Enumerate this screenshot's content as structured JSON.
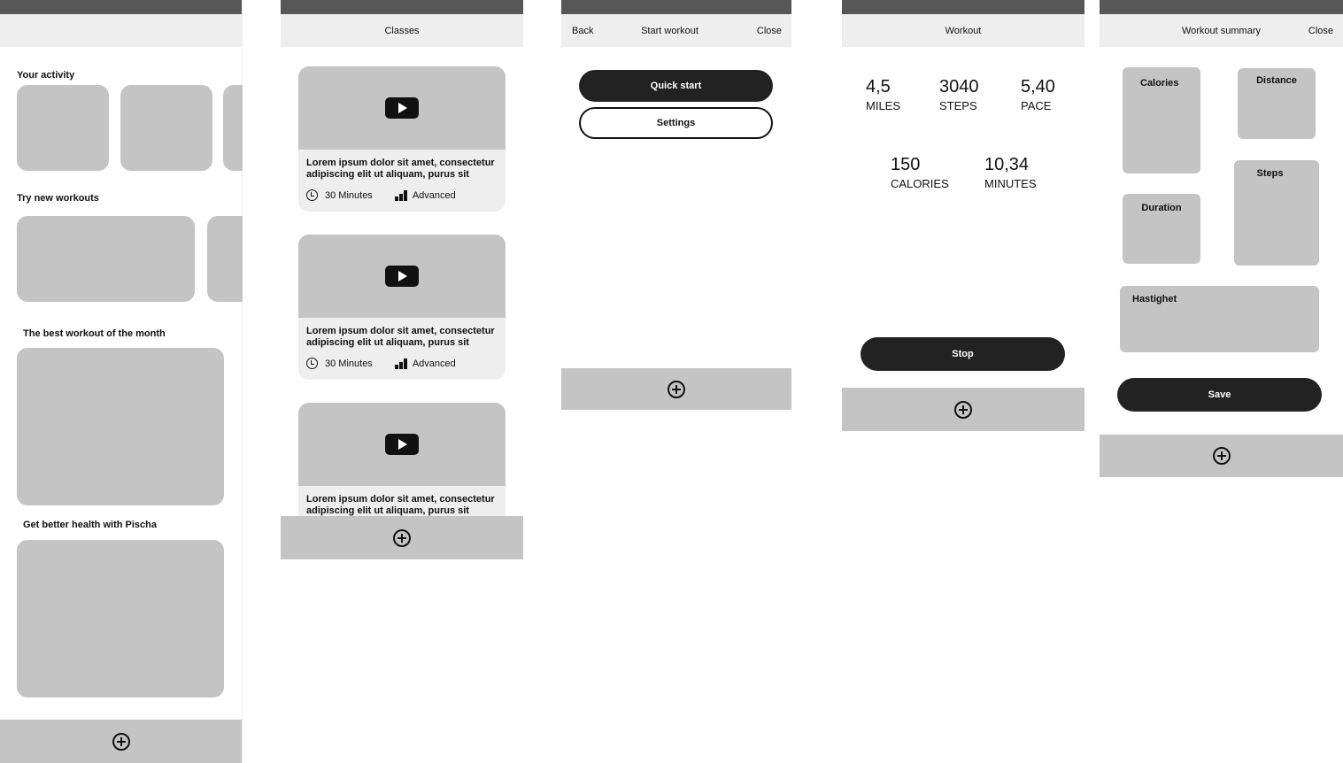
{
  "home": {
    "sections": [
      "Your activity",
      "Try new workouts",
      "The best workout of the month",
      "Get better health with Pischa"
    ]
  },
  "classes": {
    "title": "Classes",
    "cards": [
      {
        "description": "Lorem ipsum dolor sit amet, consectetur adipiscing elit ut aliquam, purus sit",
        "duration": "30 Minutes",
        "level": "Advanced"
      },
      {
        "description": "Lorem ipsum dolor sit amet, consectetur adipiscing elit ut aliquam, purus sit",
        "duration": "30 Minutes",
        "level": "Advanced"
      },
      {
        "description": "Lorem ipsum dolor sit amet, consectetur adipiscing elit ut aliquam, purus sit"
      }
    ]
  },
  "start_workout": {
    "back": "Back",
    "title": "Start workout",
    "close": "Close",
    "quick_start": "Quick start",
    "settings": "Settings"
  },
  "workout": {
    "title": "Workout",
    "stats": [
      {
        "value": "4,5",
        "unit": "MILES"
      },
      {
        "value": "3040",
        "unit": "STEPS"
      },
      {
        "value": "5,40",
        "unit": "PACE"
      },
      {
        "value": "150",
        "unit": "CALORIES"
      },
      {
        "value": "10,34",
        "unit": "MINUTES"
      }
    ],
    "stop": "Stop"
  },
  "summary": {
    "title": "Workout summary",
    "close": "Close",
    "tiles": [
      "Calories",
      "Distance",
      "Duration",
      "Steps",
      "Hastighet"
    ],
    "save": "Save"
  },
  "icons": [
    "plus-circle-icon",
    "play-icon",
    "clock-icon",
    "level-bars-icon"
  ],
  "colors": {
    "topbar": "#575757",
    "header": "#eeeeee",
    "placeholder": "#c4c4c4",
    "button": "#222222"
  }
}
